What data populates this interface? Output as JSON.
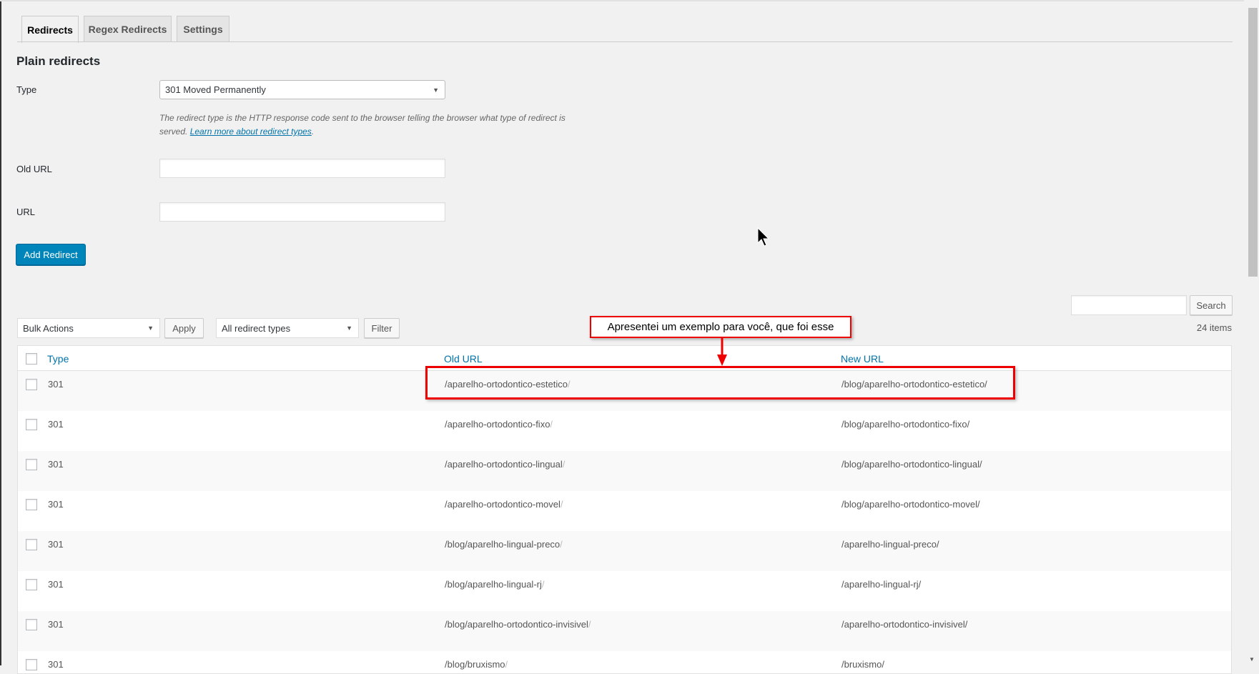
{
  "tabs": [
    {
      "label": "Redirects"
    },
    {
      "label": "Regex Redirects"
    },
    {
      "label": "Settings"
    }
  ],
  "form": {
    "title": "Plain redirects",
    "type_label": "Type",
    "type_value": "301 Moved Permanently",
    "description": "The redirect type is the HTTP response code sent to the browser telling the browser what type of redirect is served.",
    "learn_more": "Learn more about redirect types",
    "old_url_label": "Old URL",
    "old_url_value": "",
    "url_label": "URL",
    "url_value": "",
    "add_button": "Add Redirect"
  },
  "toolbar": {
    "bulk_actions": "Bulk Actions",
    "apply": "Apply",
    "type_filter": "All redirect types",
    "filter": "Filter",
    "search_value": "",
    "search": "Search",
    "count": "24 items"
  },
  "table": {
    "columns": [
      "Type",
      "Old URL",
      "New URL"
    ],
    "rows": [
      {
        "type": "301",
        "old": "/aparelho-ortodontico-estetico",
        "new": "/blog/aparelho-ortodontico-estetico/"
      },
      {
        "type": "301",
        "old": "/aparelho-ortodontico-fixo",
        "new": "/blog/aparelho-ortodontico-fixo/"
      },
      {
        "type": "301",
        "old": "/aparelho-ortodontico-lingual",
        "new": "/blog/aparelho-ortodontico-lingual/"
      },
      {
        "type": "301",
        "old": "/aparelho-ortodontico-movel",
        "new": "/blog/aparelho-ortodontico-movel/"
      },
      {
        "type": "301",
        "old": "/blog/aparelho-lingual-preco",
        "new": "/aparelho-lingual-preco/"
      },
      {
        "type": "301",
        "old": "/blog/aparelho-lingual-rj",
        "new": "/aparelho-lingual-rj/"
      },
      {
        "type": "301",
        "old": "/blog/aparelho-ortodontico-invisivel",
        "new": "/aparelho-ortodontico-invisivel/"
      },
      {
        "type": "301",
        "old": "/blog/bruxismo",
        "new": "/bruxismo/"
      }
    ]
  },
  "annotation": {
    "text": "Apresentei um exemplo para você, que foi esse",
    "color": "#e00000"
  },
  "accent": "#0085ba"
}
